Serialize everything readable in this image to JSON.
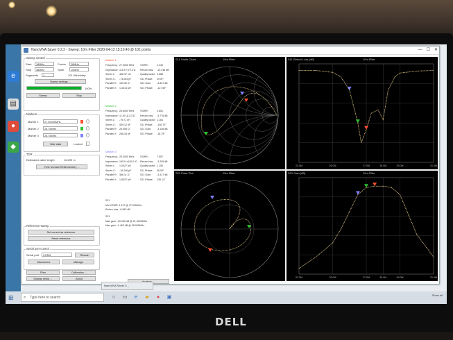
{
  "window": {
    "title": "NanoVNA Saver 0.2.2 - Sweep: 10m Filter 2020-04-12 15:10:40 @ 101 points",
    "min": "—",
    "max": "☐",
    "close": "✕"
  },
  "sweep_control": {
    "group_label": "Sweep control",
    "start_label": "Start",
    "start_value": "18MHz",
    "center_label": "Center",
    "center_value": "28MHz",
    "stop_label": "Stop",
    "stop_value": "38MHz",
    "span_label": "Span",
    "span_value": "10MHz",
    "segments_label": "Segments",
    "segments_value": "1",
    "step_label": "101.0kHz/step",
    "settings_button": "Sweep settings ...",
    "progress_percent": 100,
    "progress_text": "100%",
    "sweep_button": "Sweep",
    "stop_button": "Stop"
  },
  "markers": {
    "group_label": "Markers",
    "items": [
      {
        "label": "Marker 1",
        "value": "27.00000MHz",
        "color": "#ff5030"
      },
      {
        "label": "Marker 2",
        "value": "26.75MHz",
        "color": "#30c030"
      },
      {
        "label": "Marker 3",
        "value": "26.75MHz",
        "color": "#8080ff"
      }
    ],
    "hide_data_button": "Hide data",
    "locked_label": "Locked"
  },
  "tdr": {
    "group_label": "TDR",
    "cable_label": "Estimated cable length:",
    "cable_value": "16.299 m",
    "tdr_button": "Time Domain Reflectometry ..."
  },
  "reference_sweep": {
    "group_label": "Reference sweep",
    "set_button": "Set current as reference",
    "reset_button": "Reset reference"
  },
  "serial_control": {
    "group_label": "Serial port control",
    "port_label": "Serial port",
    "port_value": "COM3",
    "rescan_button": "Rescan",
    "disconnect_button": "Disconnect",
    "manage_button": "Manage"
  },
  "bottom_buttons": {
    "files": "Files",
    "calibration": "Calibration ...",
    "display_setup": "Display setup ...",
    "about": "About",
    "analysis": "Analysis ..."
  },
  "marker_data": [
    {
      "title": "Marker 1",
      "color": "#ff5030",
      "lines": [
        [
          "Frequency:",
          "27.0000 MHz",
          "VSWR:",
          "2.340"
        ],
        [
          "Impedance:",
          "115.5 +j79.3 Ω",
          "Return loss:",
          "-10.246 dB"
        ],
        [
          "Series L:",
          "466.37 nH",
          "Quality factor:",
          "0.686"
        ],
        [
          "Series C:",
          "-73.063 pF",
          "S11 Phase:",
          "29.57°"
        ],
        [
          "Parallel R:",
          "169.32 Ω",
          "S21 Gain:",
          "-3.837 dB"
        ],
        [
          "Parallel X:",
          "1.4014 μH",
          "S21 Phase:",
          "-127.59°"
        ]
      ]
    },
    {
      "title": "Marker 2",
      "color": "#30c030",
      "lines": [
        [
          "Frequency:",
          "26.6000 MHz",
          "VSWR:",
          "4.651"
        ],
        [
          "Impedance:",
          "11.40 -j13.3 Ω",
          "Return loss:",
          "-3.776 dB"
        ],
        [
          "Series L:",
          "-79.71 nH",
          "Quality factor:",
          "1.164"
        ],
        [
          "Series C:",
          "449.12 pF",
          "S11 Phase:",
          "-146.70°"
        ],
        [
          "Parallel R:",
          "26.955 Ω",
          "S21 Gain:",
          "-3.146 dB"
        ],
        [
          "Parallel X:",
          "258.34 pF",
          "S21 Phase:",
          "-18.79°"
        ]
      ]
    },
    {
      "title": "Marker 3",
      "color": "#8080ff",
      "lines": [
        [
          "Frequency:",
          "25.3000 MHz",
          "VSWR:",
          "7.557"
        ],
        [
          "Impedance:",
          "165.5 +j150.1 Ω",
          "Return loss:",
          "-3.209 dB"
        ],
        [
          "Series L:",
          "1.0927 μH",
          "Quality factor:",
          "1.153"
        ],
        [
          "Series C:",
          "-16.296 pF",
          "S11 Phase:",
          "36.93°"
        ],
        [
          "Parallel R:",
          "366.11 Ω",
          "S21 Gain:",
          "-3.417 dB"
        ],
        [
          "Parallel X:",
          "1.8537 μH",
          "S21 Phase:",
          "136.14°"
        ]
      ]
    }
  ],
  "summary": {
    "s11_label": "S11",
    "min_vswr": "Min VSWR:   1.117 @ 27.000MHz",
    "return_loss": "Return loss:   -6.962 dB",
    "s21_label": "S21",
    "max_gain": "Max gain:   -10.339 dB @ 21.0000MHz",
    "min_gain": "Max gain:   -1.463 dB @ 26.900MHz"
  },
  "plots": {
    "smith": {
      "title": "S11 Smith Chart",
      "name": "10m Filter"
    },
    "return_loss": {
      "title": "S11 Return Loss (dB)",
      "name": "10m Filter",
      "xticks": [
        "23.0M",
        "25.0M",
        "27.0M",
        "28.0M",
        "29.0M",
        "31.0M"
      ]
    },
    "polar": {
      "title": "S21 Polar Plot",
      "name": "10m Filter"
    },
    "gain": {
      "title": "S21 Gain (dB)",
      "name": "10m Filter",
      "xticks": [
        "23.0M",
        "25.0M",
        "27.0M",
        "28.0M",
        "29.0M",
        "31.0M"
      ]
    }
  },
  "taskbar": {
    "search_placeholder": "Type here to search",
    "task_label": "NanoVNA Saver 0...",
    "tray_text": "Show all"
  },
  "monitor": {
    "brand": "DELL"
  },
  "chart_data": [
    {
      "type": "line",
      "title": "S11 Return Loss (dB)",
      "series": [
        {
          "name": "10m Filter",
          "x": [
            23,
            24,
            25,
            25.5,
            26,
            26.5,
            26.7,
            27,
            27.3,
            27.7,
            28,
            28.3,
            28.7,
            29,
            30,
            31
          ],
          "y": [
            0,
            0,
            -0.3,
            -1,
            -3,
            -8,
            -11,
            -9,
            -6.5,
            -6,
            -7.5,
            -3,
            -1,
            -0.4,
            -0.1,
            0
          ]
        }
      ],
      "xlim": [
        23,
        31
      ],
      "ylim": [
        -14,
        1
      ]
    },
    {
      "type": "line",
      "title": "S21 Gain (dB)",
      "series": [
        {
          "name": "10m Filter",
          "x": [
            23,
            24,
            25,
            25.5,
            26,
            26.5,
            27,
            27.5,
            28,
            28.5,
            29,
            29.5,
            30,
            31
          ],
          "y": [
            -30,
            -26,
            -21,
            -16,
            -10,
            -4,
            -1.5,
            -1,
            -1,
            -1.5,
            -4,
            -11,
            -18,
            -26
          ]
        }
      ],
      "xlim": [
        23,
        31
      ],
      "ylim": [
        -32,
        2
      ]
    }
  ]
}
